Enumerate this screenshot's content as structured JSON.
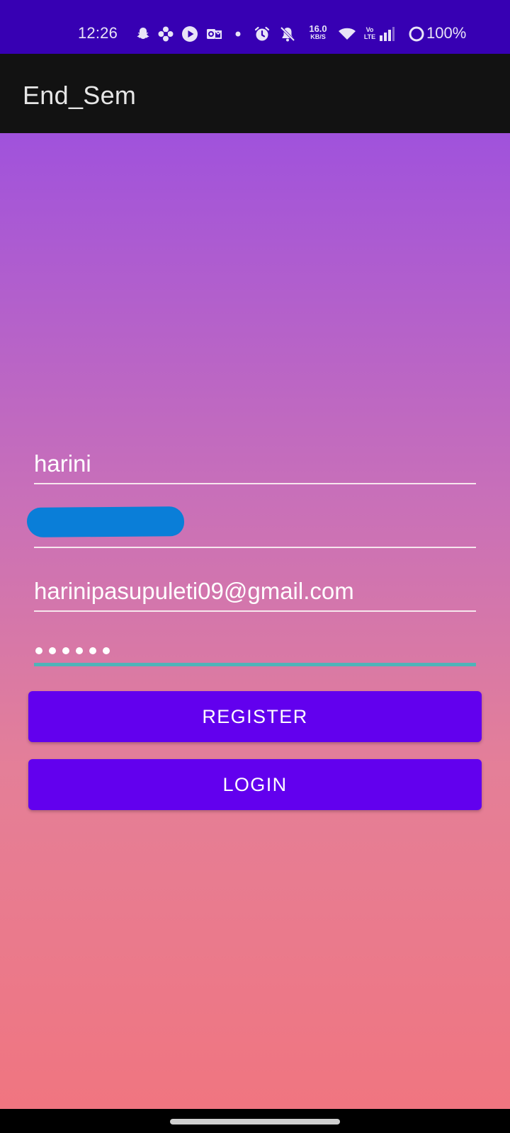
{
  "status_bar": {
    "time": "12:26",
    "net_speed_value": "16.0",
    "net_speed_unit": "KB/S",
    "volte_top": "Vo",
    "volte_bottom": "LTE",
    "battery": "100%",
    "icons": [
      "snapchat-icon",
      "flower-icon",
      "play-icon",
      "outlook-icon",
      "dot-icon",
      "alarm-icon",
      "mute-icon",
      "wifi-icon",
      "signal-icon",
      "battery-ring-icon"
    ]
  },
  "app_bar": {
    "title": "End_Sem"
  },
  "form": {
    "name_value": "harini",
    "email_value": "harinipasupuleti09@gmail.com",
    "password_length": 6
  },
  "buttons": {
    "register_label": "REGISTER",
    "login_label": "LOGIN"
  },
  "colors": {
    "status_bar": "#3700b3",
    "app_bar": "#121212",
    "button": "#6200ee",
    "focus_line": "#4fb3b8",
    "gradient_top": "#a052dc",
    "gradient_bottom": "#f07580"
  }
}
